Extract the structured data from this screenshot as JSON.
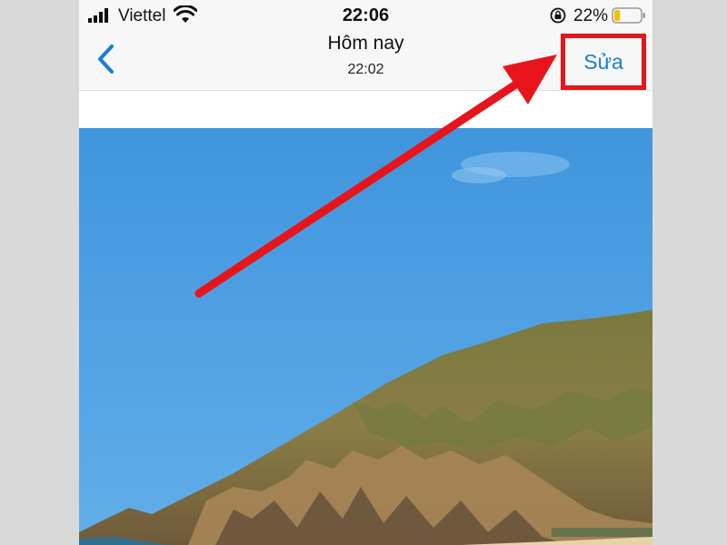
{
  "status_bar": {
    "carrier": "Viettel",
    "time": "22:06",
    "battery_percent": "22%",
    "battery_level": 0.22,
    "icons": [
      "signal-icon",
      "wifi-icon",
      "orientation-lock-icon",
      "battery-icon"
    ]
  },
  "nav": {
    "title": "Hôm nay",
    "subtitle": "22:02",
    "back_icon": "chevron-left-icon",
    "edit_label": "Sửa"
  },
  "colors": {
    "accent": "#1a7dd7",
    "highlight": "#e8141b",
    "sky": "#4a9be0"
  }
}
